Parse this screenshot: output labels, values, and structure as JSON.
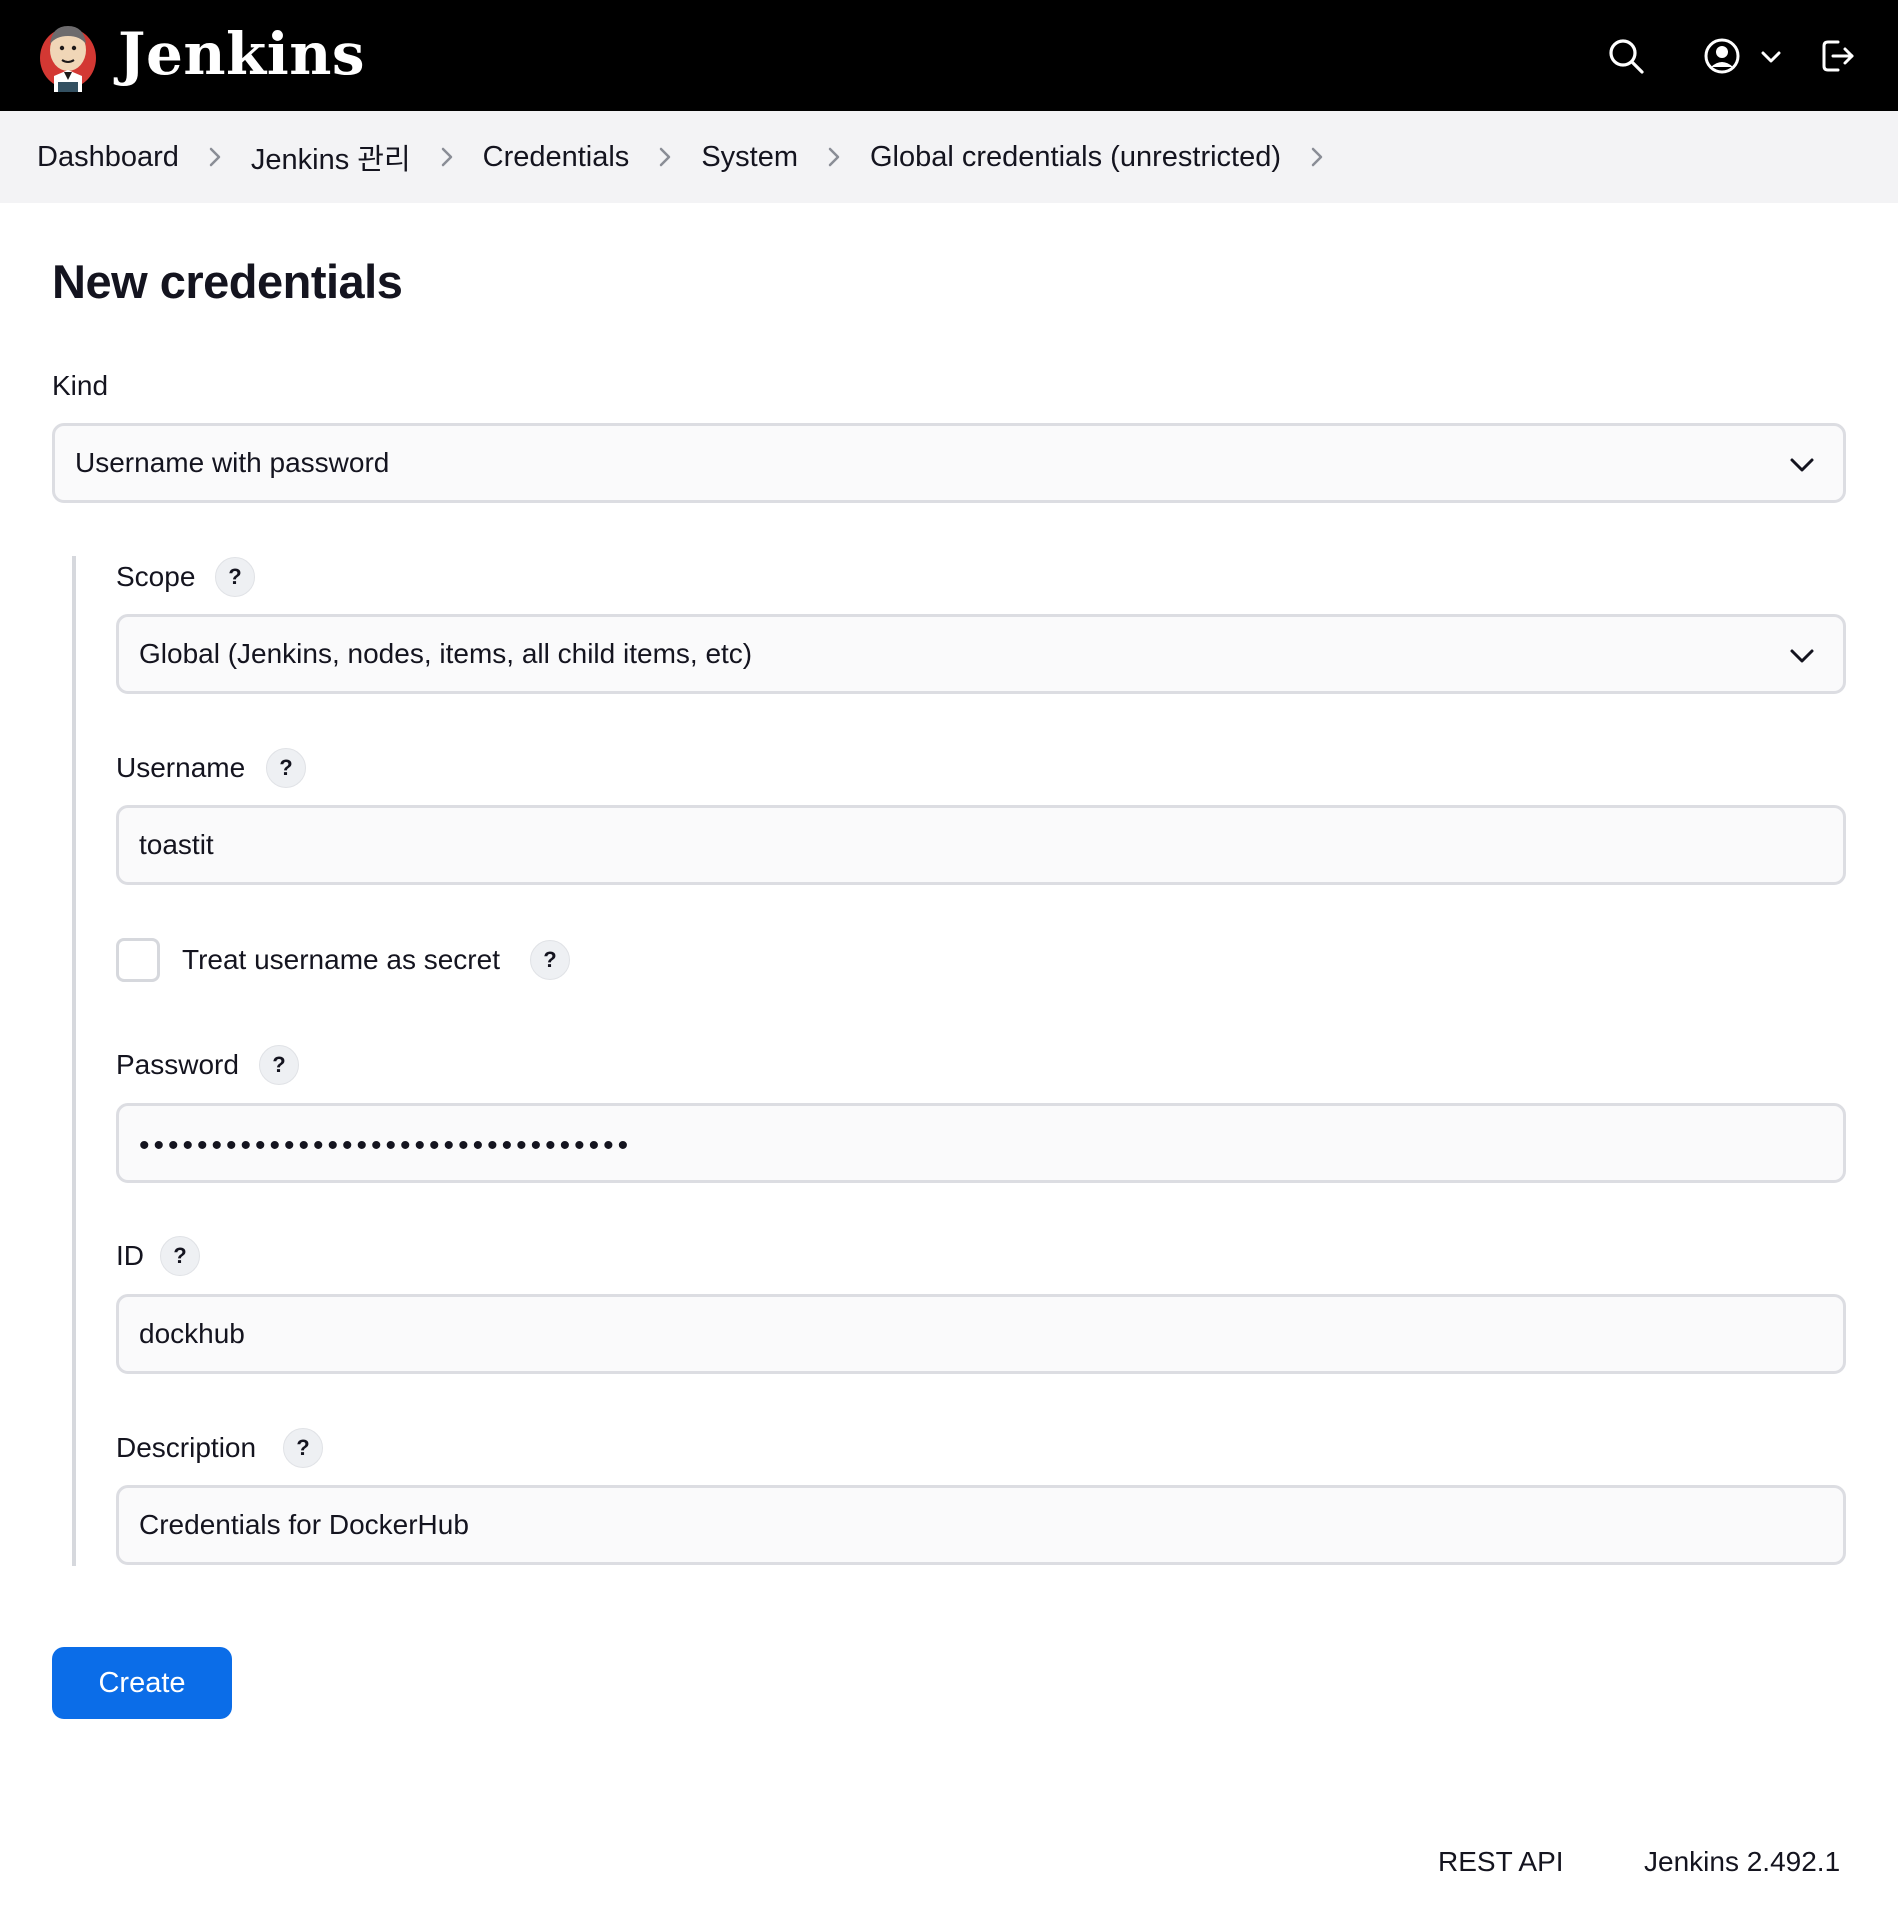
{
  "header": {
    "brand": "Jenkins",
    "icons": [
      "jenkins-logo",
      "search-icon",
      "user-icon",
      "chevron-down-icon",
      "logout-icon"
    ]
  },
  "breadcrumb": {
    "items": [
      {
        "label": "Dashboard"
      },
      {
        "label": "Jenkins 관리"
      },
      {
        "label": "Credentials"
      },
      {
        "label": "System"
      },
      {
        "label": "Global credentials (unrestricted)"
      }
    ]
  },
  "page": {
    "title": "New credentials"
  },
  "form": {
    "kind": {
      "label": "Kind",
      "value": "Username with password"
    },
    "scope": {
      "label": "Scope",
      "help": "?",
      "value": "Global (Jenkins, nodes, items, all child items, etc)"
    },
    "username": {
      "label": "Username",
      "help": "?",
      "value": "toastit"
    },
    "treat_secret": {
      "label": "Treat username as secret",
      "help": "?",
      "checked": false
    },
    "password": {
      "label": "Password",
      "help": "?",
      "masked": "••••••••••••••••••••••••••••••••••"
    },
    "id": {
      "label": "ID",
      "help": "?",
      "value": "dockhub"
    },
    "description": {
      "label": "Description",
      "help": "?",
      "value": "Credentials for DockerHub"
    },
    "submit_label": "Create"
  },
  "footer": {
    "rest_api": "REST API",
    "version": "Jenkins 2.492.1"
  },
  "colors": {
    "header_bg": "#000000",
    "breadcrumb_bg": "#f3f3f5",
    "primary_button": "#0b6de8",
    "field_border": "#dcdde2"
  }
}
